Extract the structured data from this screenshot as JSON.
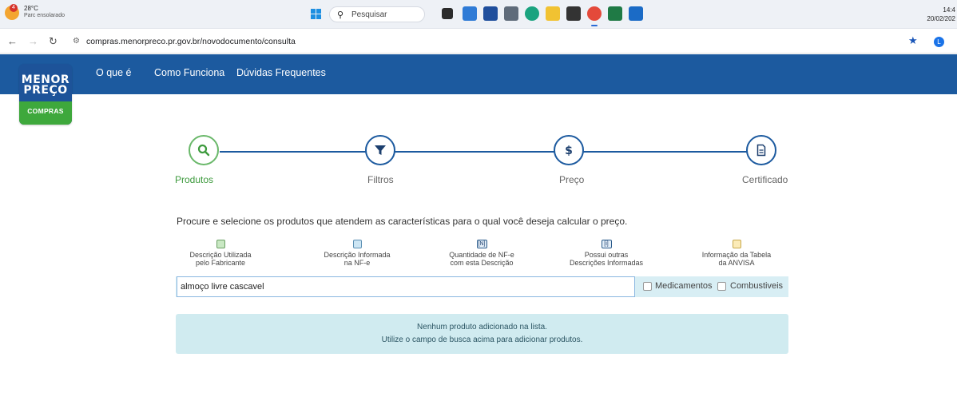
{
  "taskbar": {
    "weather": {
      "temp": "28°C",
      "condition": "Parc ensolarado",
      "badge": "4"
    },
    "search_label": "Pesquisar",
    "clock": {
      "time": "14:4",
      "date": "20/02/202"
    },
    "apps": [
      "task-view",
      "store",
      "calendar",
      "calculator",
      "edge",
      "file-explorer",
      "sticky",
      "chrome",
      "excel",
      "outlook"
    ]
  },
  "browser": {
    "url": "compras.menorpreco.pr.gov.br/novodocumento/consulta",
    "profile_initial": "L"
  },
  "site": {
    "logo": {
      "line1": "MENOR",
      "line2": "PREÇO",
      "line3": "COMPRAS"
    },
    "menu": [
      "O que é",
      "Como Funciona",
      "Dúvidas Frequentes"
    ]
  },
  "steps": [
    {
      "label": "Produtos",
      "icon": "search-icon",
      "active": true
    },
    {
      "label": "Filtros",
      "icon": "filter-icon",
      "active": false
    },
    {
      "label": "Preço",
      "icon": "dollar-icon",
      "active": false
    },
    {
      "label": "Certificado",
      "icon": "document-icon",
      "active": false
    }
  ],
  "instructions": "Procure e selecione os produtos que atendem as características para o qual você deseja calcular o preço.",
  "legend": [
    {
      "line1": "Descrição Utilizada",
      "line2": "pelo Fabricante",
      "color": "#c9e8c3"
    },
    {
      "line1": "Descrição Informada",
      "line2": "na NF-e",
      "color": "#cde6f4"
    },
    {
      "line1": "Quantidade de NF-e",
      "line2": "com esta Descrição",
      "color": "#e3eef8",
      "glyph": "[N]"
    },
    {
      "line1": "Possui outras",
      "line2": "Descrições Informadas",
      "color": "#e3eef8",
      "glyph": "[i]"
    },
    {
      "line1": "Informação da Tabela",
      "line2": "da ANVISA",
      "color": "#fbebb8"
    }
  ],
  "search": {
    "value": "almoço livre cascavel",
    "options": [
      "Medicamentos",
      "Combustiveis"
    ]
  },
  "empty_message": {
    "line1": "Nenhum produto adicionado na lista.",
    "line2": "Utilize o campo de busca acima para adicionar produtos."
  }
}
